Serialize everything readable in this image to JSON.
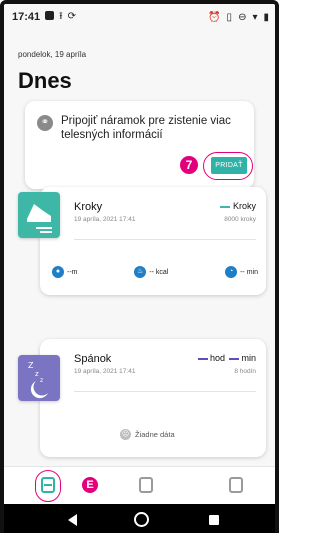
{
  "statusbar": {
    "time": "17:41",
    "left_icons": [
      "app-square-icon",
      "upload-icon",
      "sync-icon"
    ],
    "right_icons": [
      "alarm-icon",
      "vibrate-icon",
      "dnd-icon",
      "wifi-icon",
      "battery-icon"
    ]
  },
  "header": {
    "date": "pondelok, 19 apríla",
    "title": "Dnes"
  },
  "connect_card": {
    "icon": "link-icon",
    "text": "Pripojiť náramok pre zistenie viac telesných informácií",
    "annotation": "7",
    "button_label": "PRIDAŤ"
  },
  "steps_card": {
    "icon": "shoe-icon",
    "title": "Kroky",
    "timestamp": "19 apríla, 2021 17:41",
    "value_label": "Kroky",
    "goal": "8000 kroky",
    "metrics": [
      {
        "icon": "distance-icon",
        "value": "--m"
      },
      {
        "icon": "calories-icon",
        "value": "-- kcal"
      },
      {
        "icon": "clock-icon",
        "value": "-- min"
      }
    ],
    "accent": "#3fb7a6"
  },
  "sleep_card": {
    "icon": "moon-icon",
    "title": "Spánok",
    "timestamp": "19 apríla, 2021 17:41",
    "value_hours": "hod",
    "value_minutes": "min",
    "goal": "8 hodín",
    "empty_text": "Žiadne dáta",
    "accent": "#7b74c2"
  },
  "bottom_nav": {
    "items": [
      {
        "name": "today",
        "icon": "today-icon",
        "active": true
      },
      {
        "name": "device",
        "icon": "watch-icon",
        "active": false
      },
      {
        "name": "profile",
        "icon": "profile-icon",
        "active": false
      }
    ],
    "annotation": "E"
  },
  "colors": {
    "primary": "#2fb3a8",
    "annotation": "#e4007c",
    "metric_blue": "#1f7fc6"
  }
}
